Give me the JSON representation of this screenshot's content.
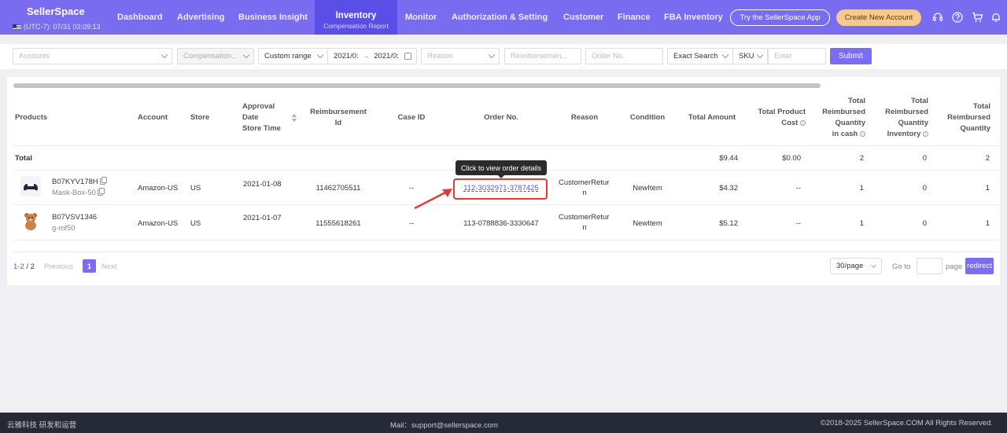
{
  "header": {
    "brand": "SellerSpace",
    "timezone": "(UTC-7): 07/31 03:09:13",
    "nav": [
      {
        "label": "Dashboard"
      },
      {
        "label": "Advertising"
      },
      {
        "label": "Business Insight"
      },
      {
        "label": "Inventory",
        "sub": "Compensation Report",
        "active": true
      },
      {
        "label": "Monitor"
      },
      {
        "label": "Authorization & Setting"
      },
      {
        "label": "Customer"
      },
      {
        "label": "Finance"
      },
      {
        "label": "FBA Inventory"
      }
    ],
    "app_button": "Try the SellerSpace App",
    "create_button": "Create New Account",
    "icons": [
      "headset-icon",
      "help-icon",
      "cart-icon",
      "bell-icon"
    ]
  },
  "filters": {
    "accounts_placeholder": "Accounts",
    "compensation_placeholder": "Compensation...",
    "range_label": "Custom range",
    "date_start": "2021/0:",
    "date_arrow": "→",
    "date_end": "2021/0:",
    "reason_placeholder": "Reason",
    "reimbursement_placeholder": "Reimbursemen...",
    "order_placeholder": "Order No.",
    "match_mode": "Exact Search",
    "search_field": "SKU",
    "search_placeholder": "Enter",
    "submit": "Submit"
  },
  "table": {
    "headers": {
      "products": "Products",
      "account": "Account",
      "store": "Store",
      "approval_date_1": "Approval",
      "approval_date_2": "Date",
      "approval_date_3": "Store Time",
      "reimbursement_id_1": "Reimbursement",
      "reimbursement_id_2": "Id",
      "case_id": "Case ID",
      "order_no": "Order No.",
      "reason": "Reason",
      "condition": "Condition",
      "total_amount": "Total Amount",
      "total_cost_1": "Total Product",
      "total_cost_2": "Cost",
      "qty_cash_1": "Total",
      "qty_cash_2": "Reimbursed",
      "qty_cash_3": "Quantity",
      "qty_cash_4": "in cash",
      "qty_inv_1": "Total",
      "qty_inv_2": "Reimbursed",
      "qty_inv_3": "Quantity",
      "qty_inv_4": "Inventory",
      "qty_total_1": "Total",
      "qty_total_2": "Reimbursed",
      "qty_total_3": "Quantity"
    },
    "total_row": {
      "label": "Total",
      "total_amount": "$9.44",
      "total_cost": "$0.00",
      "qty_cash": "2",
      "qty_inventory": "0",
      "qty_total": "2"
    },
    "rows": [
      {
        "asin": "B07KYV178H",
        "sku": "Mask-Box-50",
        "account": "Amazon-US",
        "store": "US",
        "approval_date": "2021-01-08",
        "reimbursement_id": "11462705511",
        "case_id": "--",
        "order_no": "112-3032971-3787425",
        "reason_1": "CustomerRetur",
        "reason_2": "n",
        "condition": "NewItem",
        "total_amount": "$4.32",
        "total_cost": "--",
        "qty_cash": "1",
        "qty_inventory": "0",
        "qty_total": "1"
      },
      {
        "asin": "B07VSV1346",
        "sku": "g-mf50",
        "account": "Amazon-US",
        "store": "US",
        "approval_date": "2021-01-07",
        "reimbursement_id": "11555618261",
        "case_id": "--",
        "order_no": "113-0788836-3330647",
        "reason_1": "CustomerRetur",
        "reason_2": "n",
        "condition": "NewItem",
        "total_amount": "$5.12",
        "total_cost": "--",
        "qty_cash": "1",
        "qty_inventory": "0",
        "qty_total": "1"
      }
    ],
    "tooltip": "Click to view order details"
  },
  "pagination": {
    "range": "1-2",
    "separator": "/",
    "total": "2",
    "previous": "Previous",
    "current": "1",
    "next": "Next",
    "per_page": "30/page",
    "goto": "Go to",
    "page": "page",
    "redirect": "redirect"
  },
  "footer": {
    "left": "云雅科技 研发和运营",
    "mail": "Mail：support@sellerspace.com",
    "copyright": "©2018-2025 SellerSpace.COM All Rights Reserved."
  },
  "colors": {
    "header": "#7a6cf0",
    "active_nav": "#5b4ee6",
    "primary": "#7b6cf2",
    "highlight": "#e53935",
    "footer": "#262a36"
  }
}
